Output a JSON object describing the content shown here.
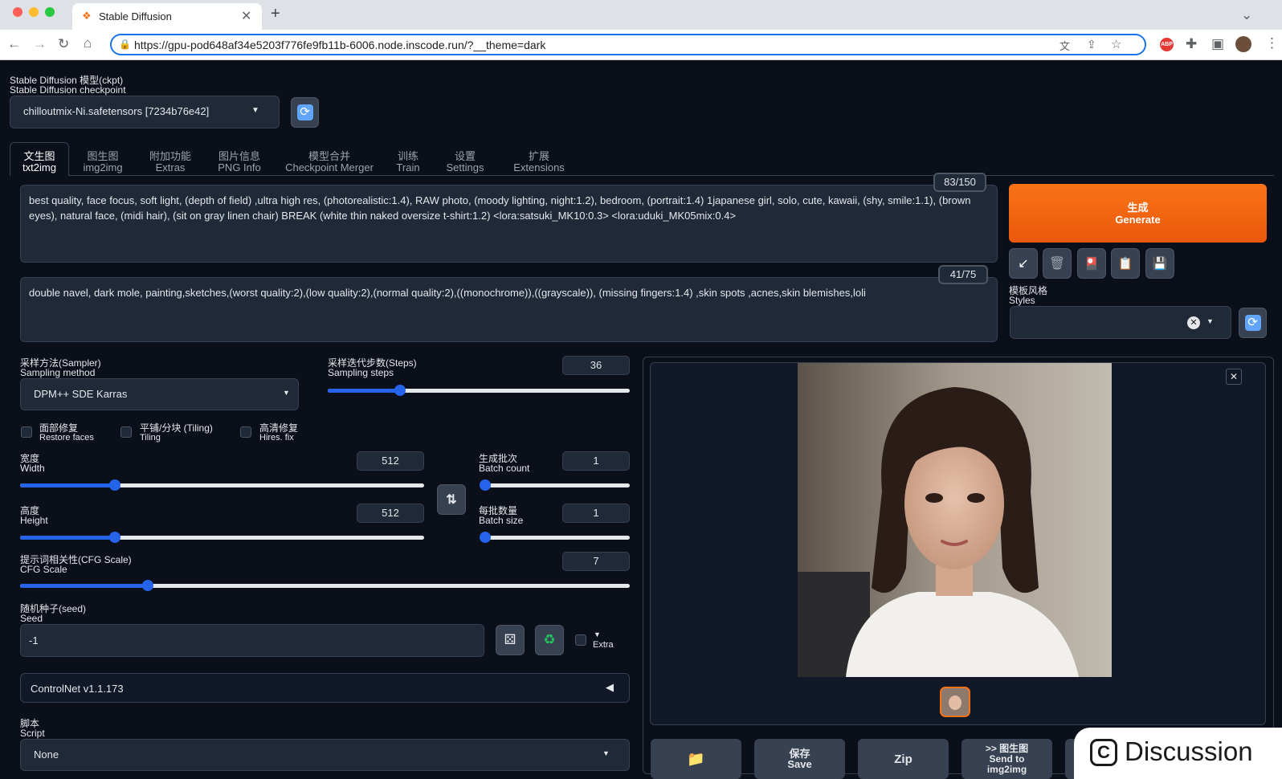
{
  "browser": {
    "tab_title": "Stable Diffusion",
    "url": "https://gpu-pod648af34e5203f776fe9fb11b-6006.node.inscode.run/?__theme=dark"
  },
  "checkpoint": {
    "label_cn": "Stable Diffusion 模型(ckpt)",
    "label_en": "Stable Diffusion checkpoint",
    "value": "chilloutmix-Ni.safetensors [7234b76e42]"
  },
  "tabs": [
    {
      "cn": "文生图",
      "en": "txt2img"
    },
    {
      "cn": "图生图",
      "en": "img2img"
    },
    {
      "cn": "附加功能",
      "en": "Extras"
    },
    {
      "cn": "图片信息",
      "en": "PNG Info"
    },
    {
      "cn": "模型合并",
      "en": "Checkpoint Merger"
    },
    {
      "cn": "训练",
      "en": "Train"
    },
    {
      "cn": "设置",
      "en": "Settings"
    },
    {
      "cn": "扩展",
      "en": "Extensions"
    }
  ],
  "prompt": {
    "text": "best quality, face focus, soft light, (depth of field) ,ultra high res, (photorealistic:1.4), RAW photo, (moody lighting, night:1.2), bedroom, (portrait:1.4) 1japanese girl, solo, cute, kawaii, (shy, smile:1.1), (brown eyes), natural face, (midi hair), (sit on gray linen chair) BREAK (white thin naked oversize t-shirt:1.2) <lora:satsuki_MK10:0.3> <lora:uduki_MK05mix:0.4>",
    "counter": "83/150"
  },
  "negative_prompt": {
    "text": "double navel, dark mole, painting,sketches,(worst quality:2),(low quality:2),(normal quality:2),((monochrome)),((grayscale)), (missing fingers:1.4) ,skin spots ,acnes,skin blemishes,loli",
    "counter": "41/75"
  },
  "generate": {
    "cn": "生成",
    "en": "Generate"
  },
  "styles": {
    "cn": "模板风格",
    "en": "Styles"
  },
  "sampler": {
    "cn": "采样方法(Sampler)",
    "en": "Sampling method",
    "value": "DPM++ SDE Karras"
  },
  "steps": {
    "cn": "采样迭代步数(Steps)",
    "en": "Sampling steps",
    "value": "36",
    "fraction": 0.24
  },
  "checkboxes": [
    {
      "cn": "面部修复",
      "en": "Restore faces"
    },
    {
      "cn": "平铺/分块 (Tiling)",
      "en": "Tiling"
    },
    {
      "cn": "高清修复",
      "en": "Hires. fix"
    }
  ],
  "width": {
    "cn": "宽度",
    "en": "Width",
    "value": "512",
    "fraction": 0.235
  },
  "height": {
    "cn": "高度",
    "en": "Height",
    "value": "512",
    "fraction": 0.235
  },
  "batch_count": {
    "cn": "生成批次",
    "en": "Batch count",
    "value": "1",
    "fraction": 0.0
  },
  "batch_size": {
    "cn": "每批数量",
    "en": "Batch size",
    "value": "1",
    "fraction": 0.0
  },
  "cfg": {
    "cn": "提示词相关性(CFG Scale)",
    "en": "CFG Scale",
    "value": "7",
    "fraction": 0.21
  },
  "seed": {
    "cn": "随机种子(seed)",
    "en": "Seed",
    "value": "-1",
    "extra": "Extra"
  },
  "controlnet": {
    "label": "ControlNet v1.1.173"
  },
  "script": {
    "cn": "脚本",
    "en": "Script",
    "value": "None"
  },
  "output_buttons": [
    {
      "cn": "",
      "en": ""
    },
    {
      "cn": "保存",
      "en": "Save"
    },
    {
      "cn": "",
      "en": "Zip"
    },
    {
      "cn": ">> 图生图",
      "en": "Send to img2img"
    }
  ],
  "overlay": {
    "label": "Discussion"
  },
  "colors": {
    "accent": "#ea580c",
    "slider": "#2563eb",
    "bg": "#0b0f19",
    "panel": "#1f2937"
  }
}
